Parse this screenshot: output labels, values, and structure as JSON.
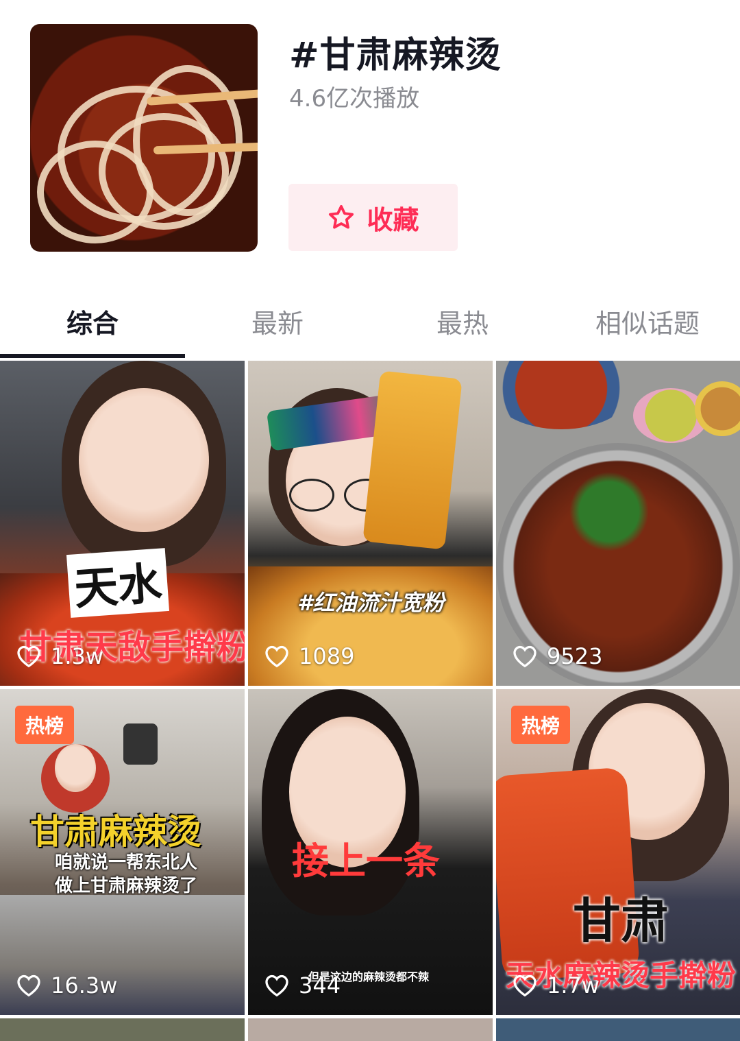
{
  "topic": {
    "title": "#甘肃麻辣烫",
    "plays": "4.6亿次播放",
    "favorite_label": "收藏"
  },
  "tabs": [
    "综合",
    "最新",
    "最热",
    "相似话题"
  ],
  "active_tab": 0,
  "videos": [
    {
      "likes": "1.3w",
      "badge": "",
      "caption_top": "天水",
      "caption_bottom": "甘肃天敌手擀粉"
    },
    {
      "likes": "1089",
      "badge": "",
      "caption_top": "#红油流汁宽粉",
      "caption_bottom": ""
    },
    {
      "likes": "9523",
      "badge": "",
      "caption_top": "",
      "caption_bottom": ""
    },
    {
      "likes": "16.3w",
      "badge": "热榜",
      "caption_top": "甘肃麻辣烫",
      "caption_bottom": "咱就说一帮东北人\n做上甘肃麻辣烫了"
    },
    {
      "likes": "344",
      "badge": "",
      "caption_top": "接上一条",
      "caption_bottom": "但是这边的麻辣烫都不辣"
    },
    {
      "likes": "1.7w",
      "badge": "热榜",
      "caption_top": "甘肃",
      "caption_bottom": "天水麻辣烫手擀粉"
    }
  ],
  "colors": {
    "accent": "#fe2c55",
    "badge": "#ff6a3d",
    "muted": "#8a8b91"
  }
}
